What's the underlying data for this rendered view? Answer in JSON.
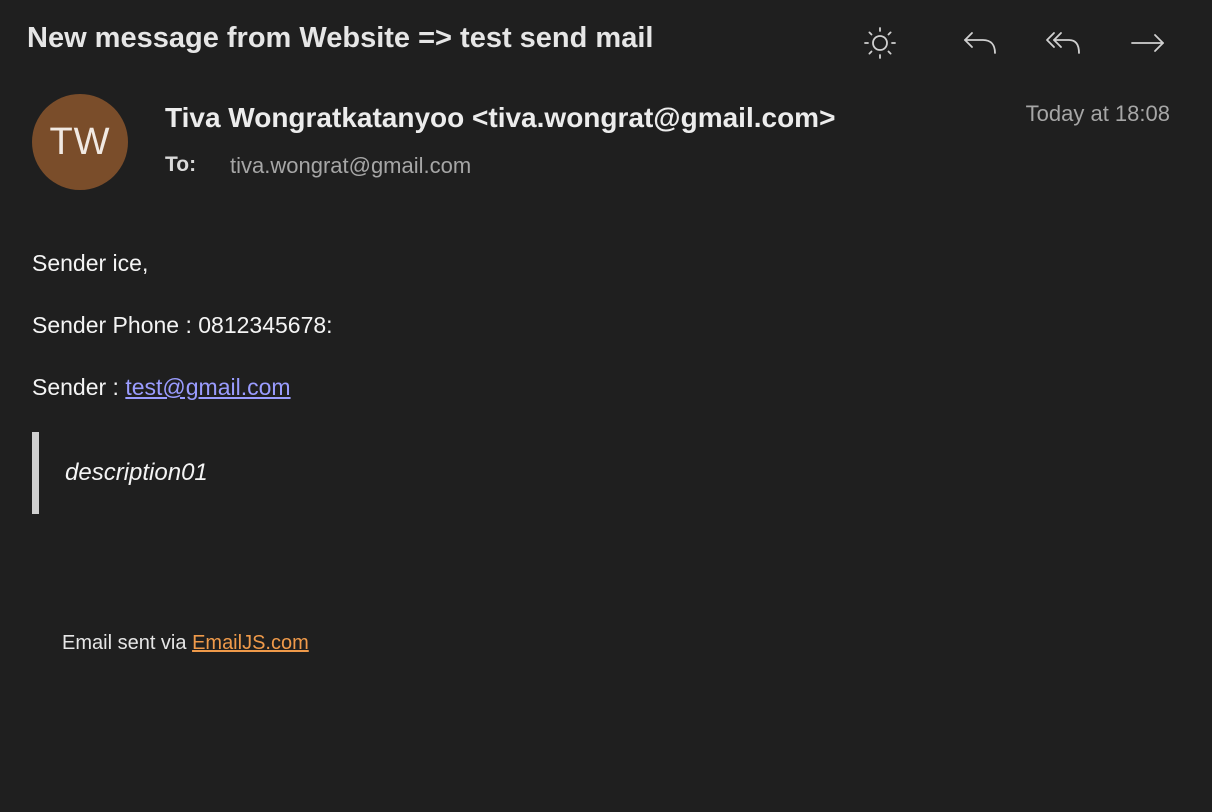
{
  "message": {
    "subject": "New message from Website => test send mail",
    "avatar_initials": "TW",
    "from": "Tiva Wongratkatanyoo <tiva.wongrat@gmail.com>",
    "to_label": "To:",
    "to_value": "tiva.wongrat@gmail.com",
    "date": "Today at 18:08"
  },
  "toolbar": {
    "icons": [
      "sun-icon",
      "reply-icon",
      "reply-all-icon",
      "forward-icon"
    ]
  },
  "body": {
    "line1": "Sender ice,",
    "line2": "Sender Phone : 0812345678:",
    "line3_prefix": "Sender : ",
    "line3_email": "test@gmail.com",
    "quote": "description01"
  },
  "footer": {
    "prefix": "Email sent via ",
    "link": "EmailJS.com"
  },
  "colors": {
    "background": "#1f1f1f",
    "avatar": "#7a4d2a",
    "link": "#9a9cff",
    "footer_link": "#ef9a4a"
  }
}
